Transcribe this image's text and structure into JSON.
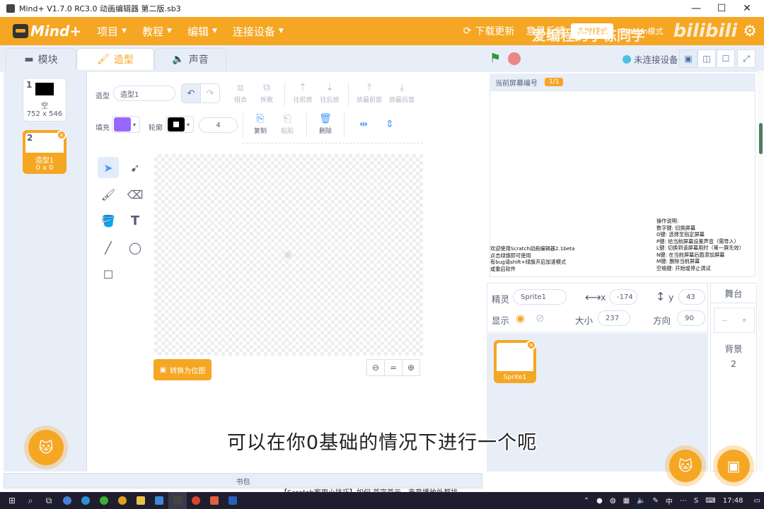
{
  "window": {
    "title": "Mind+ V1.7.0 RC3.0   动画编辑器 第二版.sb3",
    "minimize": "—",
    "maximize": "☐",
    "close": "✕"
  },
  "menubar": {
    "logo": "Mind+",
    "items": [
      "项目",
      "教程",
      "编辑",
      "连接设备"
    ],
    "download": "下载更新",
    "feedback": "意见反馈",
    "mode": "实时模式",
    "python": "Python模式",
    "watermark": "爱编程的小栋同学",
    "bili": "bilibili"
  },
  "tabs": {
    "blocks": "模块",
    "costumes": "造型",
    "sounds": "声音"
  },
  "stage_controls": {
    "connection": "未连接设备"
  },
  "costumes": [
    {
      "num": "1",
      "name": "空",
      "size": "752 x 546"
    },
    {
      "num": "2",
      "name": "造型1",
      "size": "0 x 0"
    }
  ],
  "editor": {
    "costume_label": "造型",
    "costume_name": "造型1",
    "group": "组合",
    "ungroup": "拆散",
    "forward": "往前放",
    "backward": "往后放",
    "front": "放最前面",
    "back": "放最后面",
    "fill_label": "填充",
    "outline_label": "轮廓",
    "outline_width": "4",
    "copy": "复制",
    "paste": "粘贴",
    "delete": "删除",
    "convert": "转换为位图",
    "zoom_reset": "="
  },
  "backpack": "书包",
  "stage": {
    "screen_label": "当前屏幕编号",
    "screen_badge": "1/1",
    "left_text": [
      "欢迎使用Scratch动画编辑器2.1beta",
      "点击绿旗即可使用",
      "有bug请shift+绿旗开启加速模式",
      "或重启软件"
    ],
    "right_text": [
      "操作说明:",
      "数字键: 切换屏幕",
      "O键: 选择至指定屏幕",
      "P键: 给当前屏幕设置声音（需导入）",
      "L键: 切换到该屏幕用时（第一屏无效）",
      "N键: 在当前屏幕后面添加屏幕",
      "M键: 删除当前屏幕",
      "空格键: 开始或停止调试"
    ]
  },
  "sprite_info": {
    "sprite_label": "精灵",
    "sprite_name": "Sprite1",
    "x_label": "x",
    "x": "-174",
    "y_label": "y",
    "y": "43",
    "show_label": "显示",
    "size_label": "大小",
    "size": "237",
    "dir_label": "方向",
    "dir": "90"
  },
  "sprites": [
    {
      "name": "Sprite1"
    }
  ],
  "stage_panel": {
    "title": "舞台",
    "backdrop_label": "背景",
    "backdrop_count": "2"
  },
  "subtitle": "可以在你0基础的情况下进行一个呃",
  "under_text": "【Scratch案用小技巧】如何 首字首示，声音播放外都找...",
  "taskbar": {
    "ime": "中",
    "time": "17:48"
  },
  "colors": {
    "accent": "#f5a623",
    "fill": "#9966ff",
    "outline": "#000000"
  }
}
